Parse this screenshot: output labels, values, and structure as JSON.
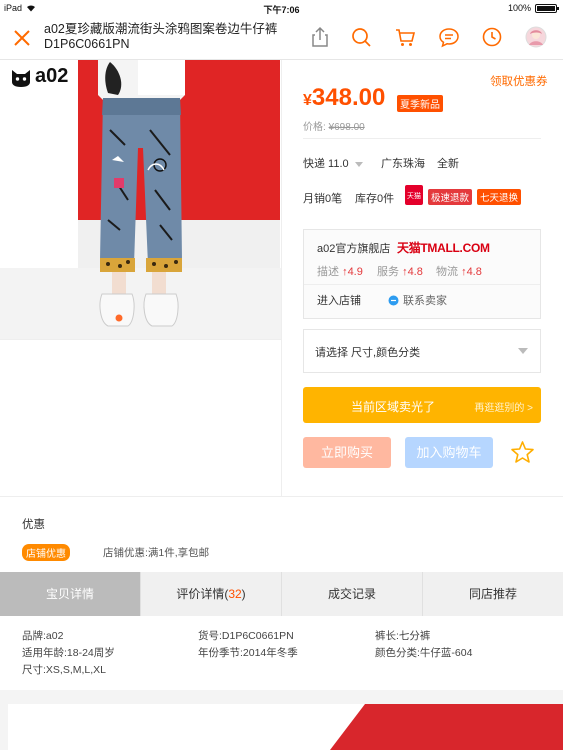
{
  "status": {
    "device": "iPad",
    "time": "下午7:06",
    "battery": "100%"
  },
  "nav": {
    "title": "a02夏珍藏版潮流街头涂鸦图案卷边牛仔裤D1P6C0661PN"
  },
  "brand": {
    "logo_text": "a02"
  },
  "price": {
    "currency": "¥",
    "current": "348.00",
    "tag": "夏季新品",
    "original_label": "价格:",
    "original": "¥698.00",
    "coupon": "领取优惠券"
  },
  "shipping": {
    "express": "快递 11.0",
    "location": "广东珠海",
    "condition": "全新"
  },
  "sales": {
    "monthly": "月销0笔",
    "stock": "库存0件",
    "tmall_badge": "天猫",
    "badge1": "极速退款",
    "badge2": "七天退换"
  },
  "shop": {
    "name": "a02官方旗舰店",
    "platform": "天猫TMALL.COM",
    "scores": [
      {
        "label": "描述",
        "value": "↑4.9"
      },
      {
        "label": "服务",
        "value": "↑4.8"
      },
      {
        "label": "物流",
        "value": "↑4.8"
      }
    ],
    "enter": "进入店铺",
    "contact": "联系卖家"
  },
  "select": {
    "label": "请选择 尺寸,颜色分类"
  },
  "actions": {
    "soldout": "当前区域卖光了",
    "soldout_sub": "再逛逛别的 >",
    "buy": "立即购买",
    "cart": "加入购物车"
  },
  "promo": {
    "title": "优惠",
    "badge": "店铺优惠",
    "text": "店铺优惠:满1件,享包邮"
  },
  "tabs": [
    {
      "label": "宝贝详情"
    },
    {
      "label": "评价详情(",
      "count": "32",
      "suffix": ")"
    },
    {
      "label": "成交记录"
    },
    {
      "label": "同店推荐"
    }
  ],
  "attributes": [
    "品牌:a02",
    "货号:D1P6C0661PN",
    "裤长:七分裤",
    "适用年龄:18-24周岁",
    "年份季节:2014年冬季",
    "颜色分类:牛仔蓝-604",
    "尺寸:XS,S,M,L,XL"
  ],
  "colors": {
    "accent": "#ff5000",
    "soldout": "#ffb400",
    "buy_disabled": "#ffb8a0",
    "cart_disabled": "#b6d6ff"
  }
}
